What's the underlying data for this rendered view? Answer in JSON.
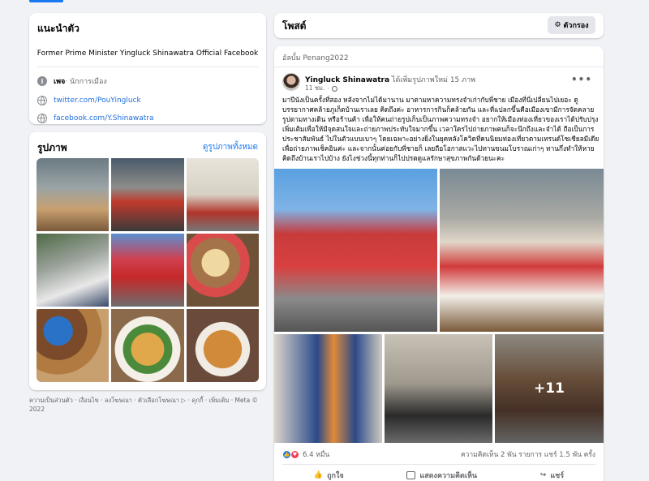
{
  "intro": {
    "title": "แนะนำตัว",
    "bio": "Former Prime Minister Yingluck Shinawatra Official Facebook",
    "page_type_bold": "เพจ",
    "page_type_rest": " · นักการเมือง",
    "twitter": "twitter.com/PouYingluck",
    "facebook": "facebook.com/Y.Shinawatra"
  },
  "photos": {
    "title": "รูปภาพ",
    "see_all": "ดูรูปภาพทั้งหมด"
  },
  "footer": {
    "text": "ความเป็นส่วนตัว · เงื่อนไข · ลงโฆษณา · ตัวเลือกโฆษณา ▷ · คุกกี้ · เพิ่มเติม · Meta © 2022"
  },
  "posts_header": {
    "title": "โพสต์",
    "filter_label": "ตัวกรอง"
  },
  "post": {
    "album": "อัลบั้ม Penang2022",
    "author": "Yingluck Shinawatra",
    "action": " ได้เพิ่มรูปภาพใหม่ 15 ภาพ",
    "time": "11 ชม.",
    "more": "•••",
    "text": "มาปีนังเป็นครั้งที่สอง หลังจากไม่ได้มานาน มาตามหาความทรงจำเก่ากับพี่ชาย เมืองที่นี่เปลี่ยนไปเยอะ ดูบรรยากาศคล้ายภูเก็ตบ้านเราเลย คิดถึงค่ะ อาหารการกินก็คล้ายกัน และที่แปลกขึ้นคือเมืองเขามีการจัดคลายรูปตามทางเดิน หรือร้านค้า เพื่อให้คนถ่ายรูปเก็บเป็นภาพความทรงจำ อยากให้เมืองท่องเที่ยวของเราได้ปรับปรุงเพิ่มเติมเพื่อให้มีจุดสนใจและถ่ายภาพประทับใจมากขึ้น เวลาใครไปถ่ายภาพคนก็จะนึกถึงและจำได้ ถือเป็นการประชาสัมพันธ์ ไปในตัวแบบเบาๆ โดยเฉพาะอย่างยิ่งในยุคหลังโควิดที่คนนิยมท่องเที่ยวตามเทรนด์โซเชียลมีเดียเพื่อถ่ายภาพเช็คอินค่ะ และจากนั้นค่อยกับพี่ชายก็ เลยถือโอกาสแวะไปทานขนมโบราณเก่าๆ ทานกึ่งทำให้หายคิดถึงบ้านเราไปบ้าง ยังไงช่วงนี้ทุกท่านก็ไปปรดดูแลรักษาสุขภาพกันด้วยนะคะ",
    "plus_count": "+11",
    "reactions": "6.4 หมื่น",
    "comments_shares": "ความคิดเห็น 2 พัน รายการ  แชร์ 1.5 พัน ครั้ง",
    "like_label": "ถูกใจ",
    "comment_label": "แสดงความคิดเห็น",
    "share_label": "แชร์"
  },
  "colors": {
    "accent": "#1877f2",
    "background": "#f0f2f5",
    "link": "#216fdb"
  }
}
